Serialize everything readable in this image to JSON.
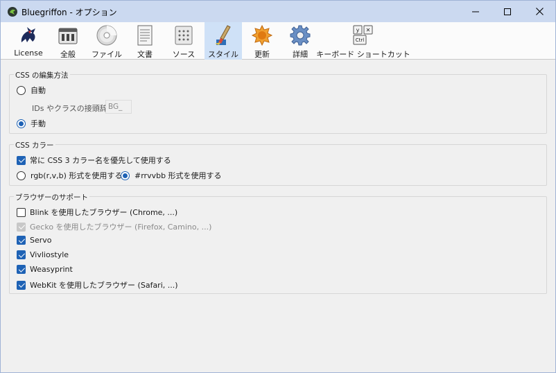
{
  "window": {
    "title": "Bluegriffon - オプション"
  },
  "toolbar": {
    "items": [
      {
        "label": "License",
        "icon": "gryphon-icon"
      },
      {
        "label": "全般",
        "icon": "general-icon"
      },
      {
        "label": "ファイル",
        "icon": "disc-icon"
      },
      {
        "label": "文書",
        "icon": "document-icon"
      },
      {
        "label": "ソース",
        "icon": "source-icon"
      },
      {
        "label": "スタイル",
        "icon": "style-brush-icon",
        "active": true
      },
      {
        "label": "更新",
        "icon": "update-icon"
      },
      {
        "label": "詳細",
        "icon": "gear-icon"
      },
      {
        "label": "キーボード ショートカット",
        "icon": "keyboard-shortcut-icon"
      }
    ],
    "key_labels": {
      "y": "y",
      "x": "✕",
      "ctrl": "Ctrl"
    }
  },
  "css_edit": {
    "legend": "CSS の編集方法",
    "auto_label": "自動",
    "prefix_label": "IDs やクラスの接頭辞:",
    "prefix_value": "BG_",
    "manual_label": "手動",
    "selected": "manual"
  },
  "css_color": {
    "legend": "CSS カラー",
    "always_names_label": "常に CSS 3 カラー名を優先して使用する",
    "always_names_checked": true,
    "rgb_label": "rgb(r,v,b) 形式を使用する",
    "hex_label": "#rrvvbb 形式を使用する",
    "selected": "hex"
  },
  "browser_support": {
    "legend": "ブラウザーのサポート",
    "items": [
      {
        "label": "Blink を使用したブラウザー (Chrome, ...)",
        "checked": false,
        "disabled": false
      },
      {
        "label": "Gecko を使用したブラウザー (Firefox, Camino, ...)",
        "checked": true,
        "disabled": true
      },
      {
        "label": "Servo",
        "checked": true,
        "disabled": false
      },
      {
        "label": "Vivliostyle",
        "checked": true,
        "disabled": false
      },
      {
        "label": "Weasyprint",
        "checked": true,
        "disabled": false
      },
      {
        "label": "WebKit を使用したブラウザー (Safari, ...)",
        "checked": true,
        "disabled": false
      }
    ]
  },
  "colors": {
    "accent": "#1e62b5",
    "titlebar": "#cbd9f0",
    "active_tab": "#cfe1f7"
  }
}
